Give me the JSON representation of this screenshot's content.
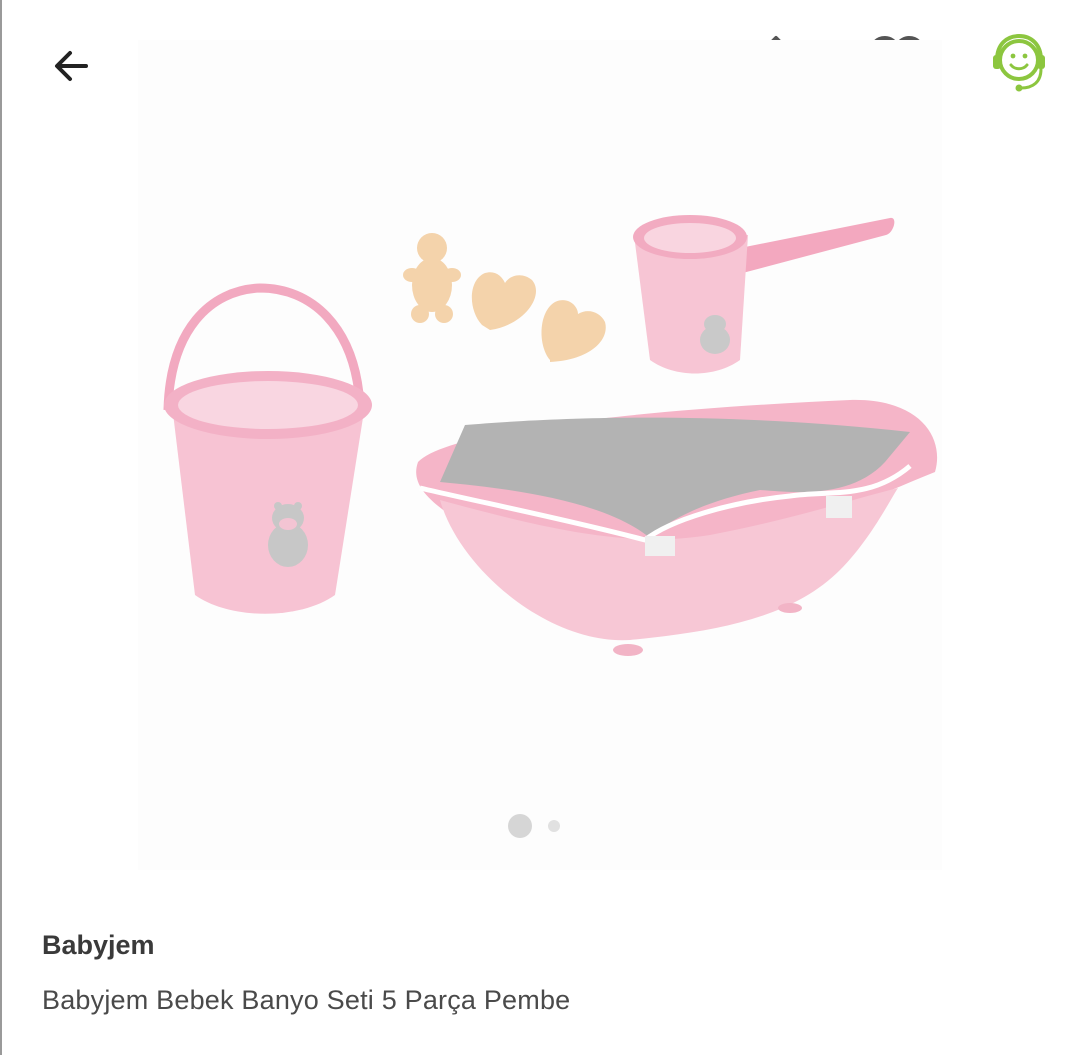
{
  "header": {
    "back_icon": "arrow-left-icon",
    "share_icon": "share-icon",
    "favorite_icon": "heart-icon",
    "support_icon": "support-agent-icon",
    "support_color": "#8CC63F"
  },
  "gallery": {
    "image_alt": "Babyjem Bebek Banyo Seti 5 Parça Pembe",
    "active_index": 1,
    "total": 2
  },
  "product": {
    "brand": "Babyjem",
    "title": "Babyjem Bebek Banyo Seti 5 Parça Pembe"
  }
}
